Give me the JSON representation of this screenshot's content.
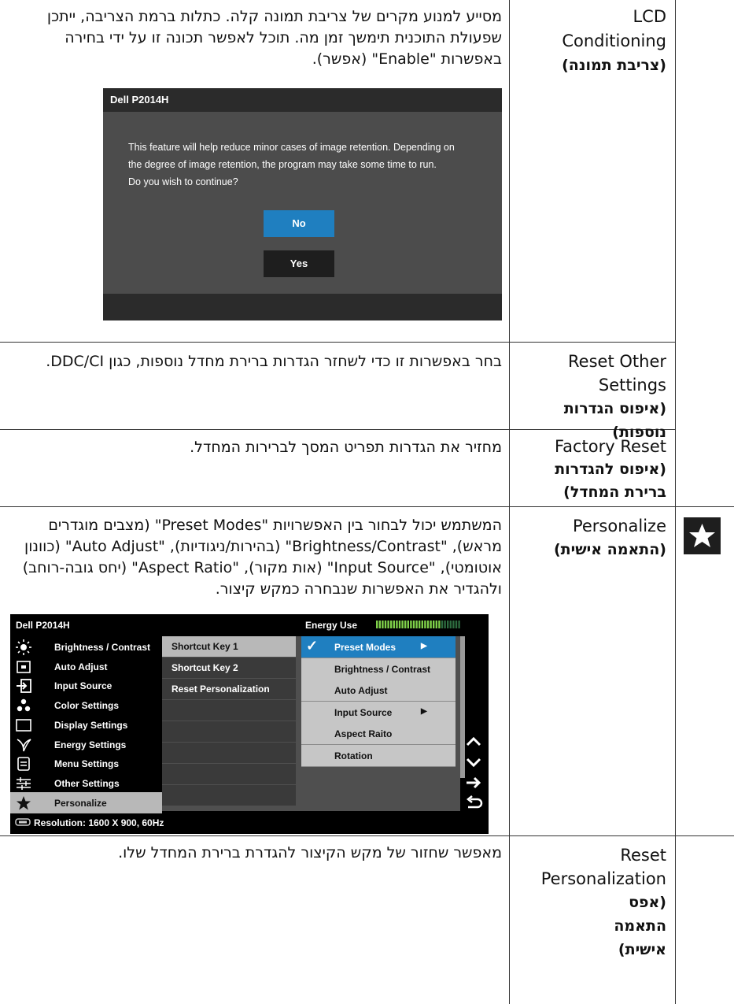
{
  "rows": [
    {
      "title_en": "LCD Conditioning",
      "title_he": "(צריבת תמונה)",
      "desc": "מסייע למנוע מקרים של צריבת תמונה קלה. כתלות ברמת הצריבה, ייתכן שפעולת התוכנית תימשך זמן מה. תוכל לאפשר תכונה זו על ידי בחירה באפשרות \"Enable\" (אפשר)."
    },
    {
      "title_en": "Reset Other Settings",
      "title_he": "(איפוס הגדרות נוספות)",
      "desc": "בחר באפשרות זו כדי לשחזר הגדרות ברירת מחדל נוספות, כגון DDC/CI."
    },
    {
      "title_en": "Factory Reset",
      "title_he": "(איפוס להגדרות ברירת המחדל)",
      "desc": "מחזיר את הגדרות תפריט המסך לברירות המחדל."
    },
    {
      "title_en": "Personalize",
      "title_he": "(התאמה אישית)",
      "desc": "המשתמש יכול לבחור בין האפשרויות \"Preset Modes\" (מצבים מוגדרים מראש), \"Brightness/Contrast\" (בהירות/ניגודיות), \"Auto Adjust\" (כוונון אוטומטי), \"Input Source\" (אות מקור), \"Aspect Ratio\" (יחס גובה-רוחב) ולהגדיר את האפשרות שנבחרה כמקש קיצור.",
      "icon": "star-icon"
    },
    {
      "title_en": "Reset Personalization",
      "title_he": "(אפס התאמה אישית)",
      "desc": "מאפשר שחזור של מקש הקיצור להגדרת ברירת המחדל שלו."
    }
  ],
  "dialog": {
    "title": "Dell P2014H",
    "message_lines": [
      "This feature will help reduce minor cases of image retention. Depending on",
      "the degree of image retention, the program may take some time to run.",
      "Do you wish to continue?"
    ],
    "no_label": "No",
    "yes_label": "Yes",
    "no_color": "#1f7fc0",
    "yes_color": "#1e1e1e"
  },
  "osd": {
    "title": "Dell P2014H",
    "energy_label": "Energy Use",
    "energy_level": 0.78,
    "menu": [
      {
        "label": "Brightness / Contrast",
        "icon": "sun-icon"
      },
      {
        "label": "Auto Adjust",
        "icon": "auto-adjust-icon"
      },
      {
        "label": "Input Source",
        "icon": "input-source-icon"
      },
      {
        "label": "Color Settings",
        "icon": "color-dots-icon"
      },
      {
        "label": "Display Settings",
        "icon": "display-icon"
      },
      {
        "label": "Energy Settings",
        "icon": "leaf-icon"
      },
      {
        "label": "Menu Settings",
        "icon": "menu-icon"
      },
      {
        "label": "Other Settings",
        "icon": "sliders-icon"
      },
      {
        "label": "Personalize",
        "icon": "star-icon",
        "selected": true
      }
    ],
    "shortcut_keys": [
      "Shortcut Key 1",
      "Shortcut Key 2",
      "Reset Personalization"
    ],
    "options": [
      {
        "label": "Preset Modes",
        "checked": true,
        "arrow": true,
        "selected": true
      },
      {
        "label": "Brightness / Contrast"
      },
      {
        "label": "Auto Adjust"
      },
      {
        "label": "Input Source",
        "arrow": true
      },
      {
        "label": "Aspect Raito"
      },
      {
        "label": "Rotation"
      }
    ],
    "resolution": "Resolution: 1600 X 900, 60Hz",
    "highlight_color": "#1f7fc0"
  }
}
